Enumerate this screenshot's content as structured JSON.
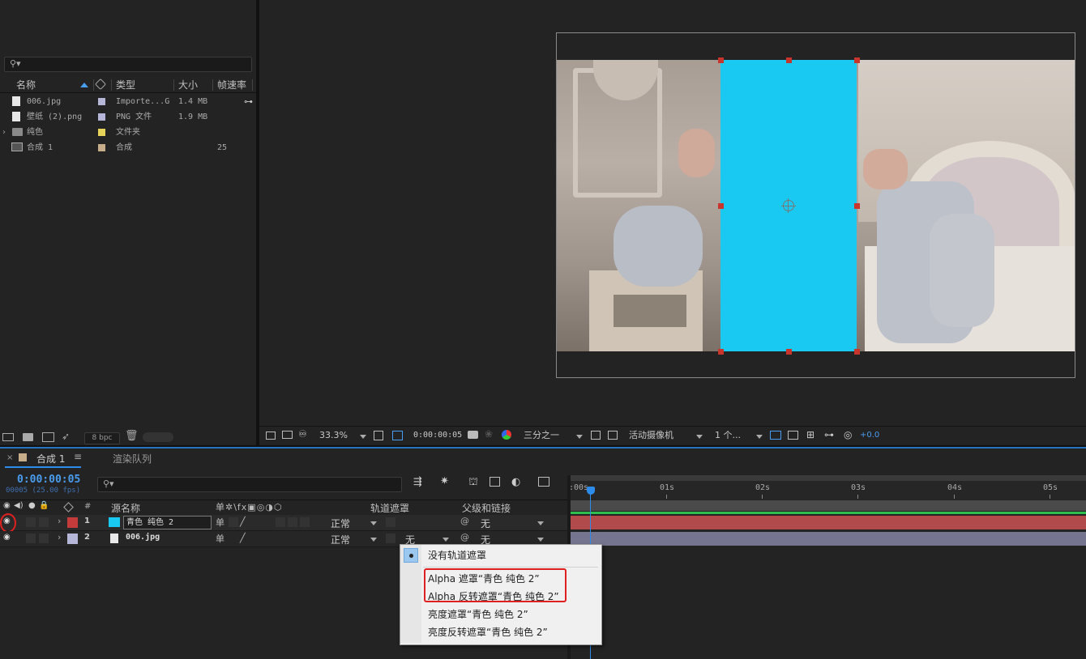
{
  "project": {
    "search_placeholder": "",
    "columns": {
      "name": "名称",
      "type": "类型",
      "size": "大小",
      "fps": "帧速率"
    },
    "items": [
      {
        "name": "006.jpg",
        "type": "Importe...G",
        "size": "1.4 MB",
        "fps": "",
        "icon": "image-file-icon",
        "color": "#b6b6d8"
      },
      {
        "name": "壁纸 (2).png",
        "type": "PNG 文件",
        "size": "1.9 MB",
        "fps": "",
        "icon": "image-file-icon",
        "color": "#b6b6d8"
      },
      {
        "name": "纯色",
        "type": "文件夹",
        "size": "",
        "fps": "",
        "icon": "folder-icon",
        "color": "#e6d35a"
      },
      {
        "name": "合成 1",
        "type": "合成",
        "size": "",
        "fps": "25",
        "icon": "composition-icon",
        "color": "#c7ad8a"
      }
    ],
    "bpc": "8 bpc"
  },
  "viewer": {
    "zoom": "33.3%",
    "timecode": "0:00:00:05",
    "grid": "三分之一",
    "camera": "活动摄像机",
    "views": "1 个...",
    "exposure": "+0.0",
    "solid_color": "#1ac9f2"
  },
  "timeline": {
    "tab_comp": "合成 1",
    "tab_render": "渲染队列",
    "timecode": "0:00:00:05",
    "frame_info": "00005 (25.00 fps)",
    "search_placeholder": "",
    "headers": {
      "num": "#",
      "source": "源名称",
      "trackmatte": "轨道遮罩",
      "parent": "父级和链接"
    },
    "layers": [
      {
        "num": "1",
        "name": "青色 纯色 2",
        "mode": "正常",
        "matte": "",
        "parent": "无",
        "label_color": "#c43b3b",
        "swatch": "#1ac9f2"
      },
      {
        "num": "2",
        "name": "006.jpg",
        "mode": "正常",
        "matte": "无",
        "parent": "无",
        "label_color": "#b6b6d8",
        "swatch": "#ffffff"
      }
    ],
    "ruler": [
      ":00s",
      "01s",
      "02s",
      "03s",
      "04s",
      "05s"
    ]
  },
  "matte_menu": {
    "items": [
      "没有轨道遮罩",
      "Alpha 遮罩“青色 纯色 2”",
      "Alpha 反转遮罩“青色 纯色 2”",
      "亮度遮罩“青色 纯色 2”",
      "亮度反转遮罩“青色 纯色 2”"
    ]
  }
}
